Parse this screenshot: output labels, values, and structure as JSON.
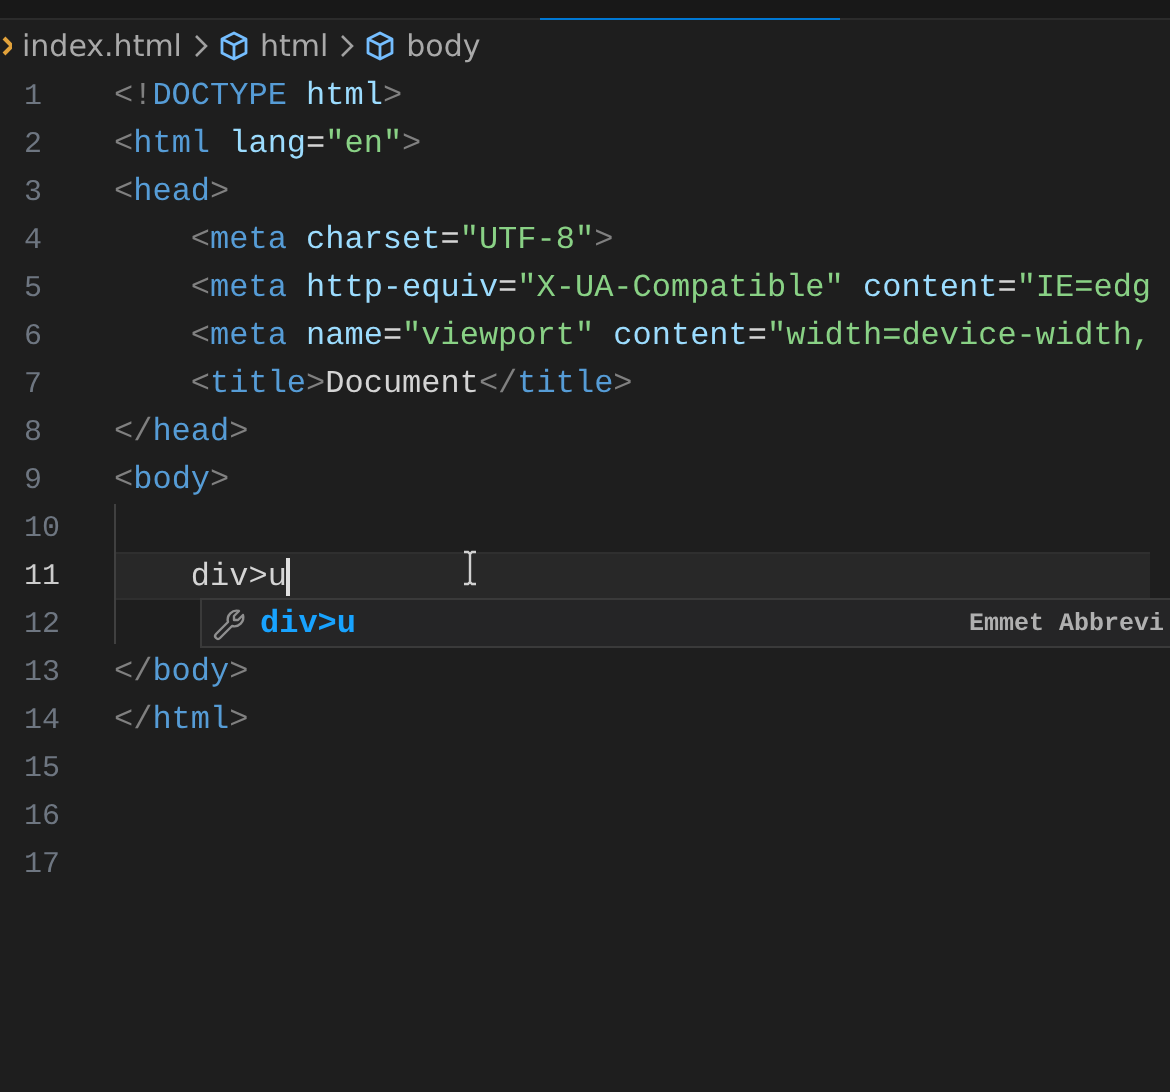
{
  "breadcrumbs": [
    {
      "label": "index.html",
      "kind": "file"
    },
    {
      "label": "html",
      "kind": "element"
    },
    {
      "label": "body",
      "kind": "element"
    }
  ],
  "lines": [
    {
      "number": "1",
      "current": false,
      "tokens": [
        {
          "t": "<!",
          "kind": "punct"
        },
        {
          "t": "DOCTYPE",
          "kind": "tag"
        },
        {
          "t": " html",
          "kind": "attr"
        },
        {
          "t": ">",
          "kind": "punct"
        }
      ]
    },
    {
      "number": "2",
      "current": false,
      "tokens": [
        {
          "t": "<",
          "kind": "punct"
        },
        {
          "t": "html",
          "kind": "tag"
        },
        {
          "t": " lang",
          "kind": "attr"
        },
        {
          "t": "=",
          "kind": "plain"
        },
        {
          "t": "\"en\"",
          "kind": "string"
        },
        {
          "t": ">",
          "kind": "punct"
        }
      ]
    },
    {
      "number": "3",
      "current": false,
      "tokens": [
        {
          "t": "<",
          "kind": "punct"
        },
        {
          "t": "head",
          "kind": "tag"
        },
        {
          "t": ">",
          "kind": "punct"
        }
      ]
    },
    {
      "number": "4",
      "current": false,
      "tokens": [
        {
          "t": "    <",
          "kind": "punct"
        },
        {
          "t": "meta",
          "kind": "tag"
        },
        {
          "t": " charset",
          "kind": "attr"
        },
        {
          "t": "=",
          "kind": "plain"
        },
        {
          "t": "\"UTF-8\"",
          "kind": "string"
        },
        {
          "t": ">",
          "kind": "punct"
        }
      ]
    },
    {
      "number": "5",
      "current": false,
      "tokens": [
        {
          "t": "    <",
          "kind": "punct"
        },
        {
          "t": "meta",
          "kind": "tag"
        },
        {
          "t": " http-equiv",
          "kind": "attr"
        },
        {
          "t": "=",
          "kind": "plain"
        },
        {
          "t": "\"X-UA-Compatible\"",
          "kind": "string"
        },
        {
          "t": " content",
          "kind": "attr"
        },
        {
          "t": "=",
          "kind": "plain"
        },
        {
          "t": "\"IE=edg",
          "kind": "string"
        }
      ]
    },
    {
      "number": "6",
      "current": false,
      "tokens": [
        {
          "t": "    <",
          "kind": "punct"
        },
        {
          "t": "meta",
          "kind": "tag"
        },
        {
          "t": " name",
          "kind": "attr"
        },
        {
          "t": "=",
          "kind": "plain"
        },
        {
          "t": "\"viewport\"",
          "kind": "string"
        },
        {
          "t": " content",
          "kind": "attr"
        },
        {
          "t": "=",
          "kind": "plain"
        },
        {
          "t": "\"width=device-width,",
          "kind": "string"
        }
      ]
    },
    {
      "number": "7",
      "current": false,
      "tokens": [
        {
          "t": "    <",
          "kind": "punct"
        },
        {
          "t": "title",
          "kind": "tag"
        },
        {
          "t": ">",
          "kind": "punct"
        },
        {
          "t": "Document",
          "kind": "plain"
        },
        {
          "t": "</",
          "kind": "punct"
        },
        {
          "t": "title",
          "kind": "tag"
        },
        {
          "t": ">",
          "kind": "punct"
        }
      ]
    },
    {
      "number": "8",
      "current": false,
      "tokens": [
        {
          "t": "</",
          "kind": "punct"
        },
        {
          "t": "head",
          "kind": "tag"
        },
        {
          "t": ">",
          "kind": "punct"
        }
      ]
    },
    {
      "number": "9",
      "current": false,
      "tokens": [
        {
          "t": "<",
          "kind": "punct"
        },
        {
          "t": "body",
          "kind": "tag"
        },
        {
          "t": ">",
          "kind": "punct"
        }
      ]
    },
    {
      "number": "10",
      "current": false
    },
    {
      "number": "11",
      "current": true,
      "tokens": [
        {
          "t": "    div>u",
          "kind": "plain"
        }
      ]
    },
    {
      "number": "12",
      "current": false
    },
    {
      "number": "13",
      "current": false,
      "tokens": [
        {
          "t": "</",
          "kind": "punct"
        },
        {
          "t": "body",
          "kind": "tag"
        },
        {
          "t": ">",
          "kind": "punct"
        }
      ]
    },
    {
      "number": "14",
      "current": false,
      "tokens": [
        {
          "t": "</",
          "kind": "punct"
        },
        {
          "t": "html",
          "kind": "tag"
        },
        {
          "t": ">",
          "kind": "punct"
        }
      ]
    },
    {
      "number": "15",
      "current": false
    },
    {
      "number": "16",
      "current": false
    },
    {
      "number": "17",
      "current": false
    }
  ],
  "suggestion": {
    "label": "div>u",
    "detail": "Emmet Abbrevi"
  }
}
